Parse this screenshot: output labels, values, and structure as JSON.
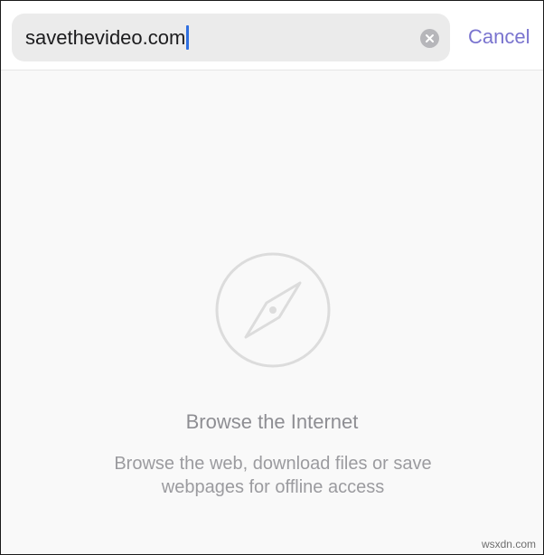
{
  "search": {
    "value": "savethevideo.com"
  },
  "header": {
    "cancel_label": "Cancel"
  },
  "icons": {
    "clear": "clear-icon",
    "empty_state": "compass-icon"
  },
  "empty_state": {
    "title": "Browse the Internet",
    "description_line1": "Browse the web, download files or save",
    "description_line2": "webpages for offline access"
  },
  "watermark": "wsxdn.com",
  "colors": {
    "accent": "#7a74cf",
    "caret": "#2f6fe0",
    "secondary_text": "#8e8e93"
  }
}
